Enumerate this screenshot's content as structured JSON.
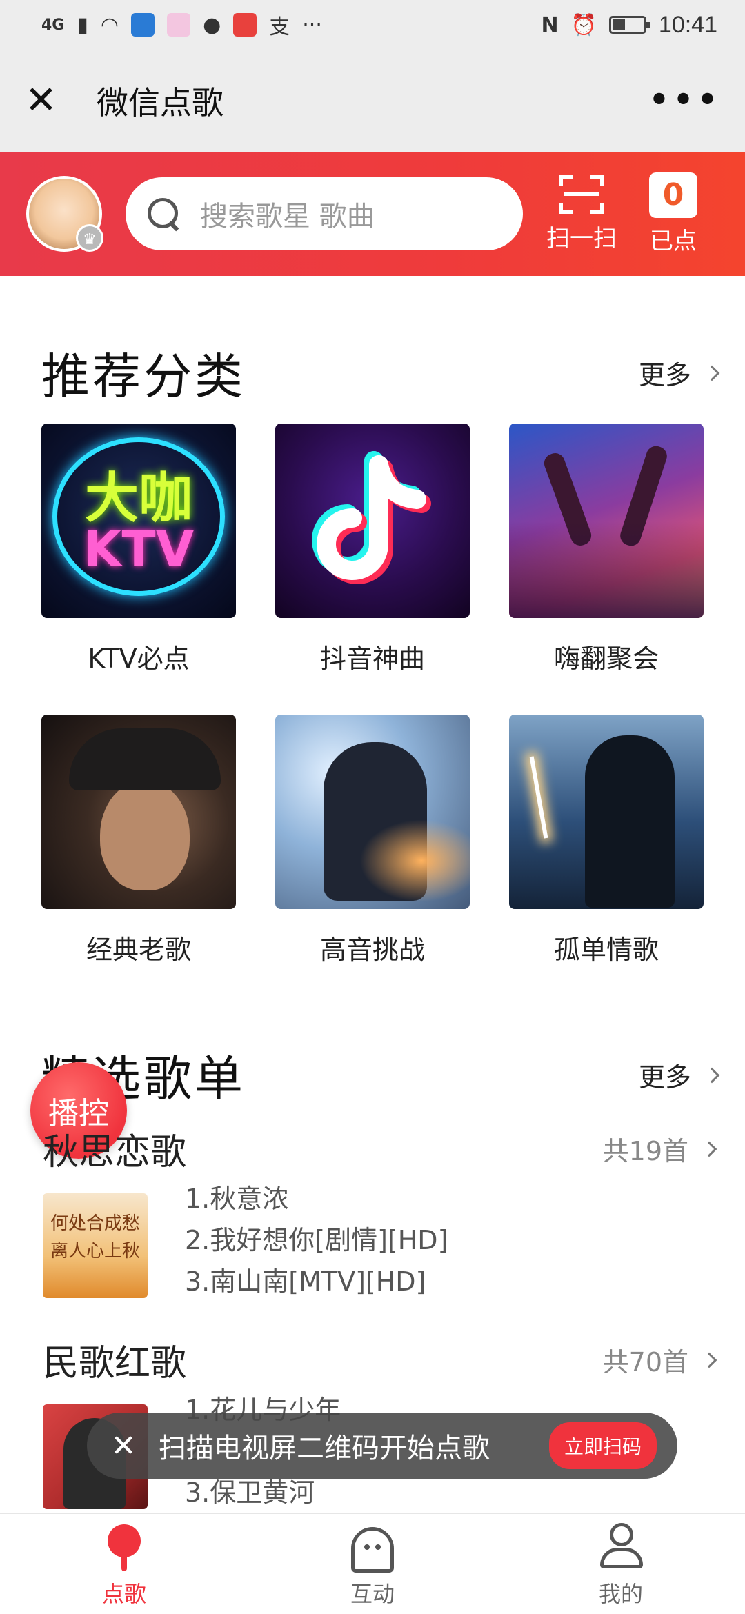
{
  "status_bar": {
    "network": "4G",
    "time": "10:41",
    "nfc_label": "N"
  },
  "titlebar": {
    "close_glyph": "✕",
    "title": "微信点歌",
    "menu_glyph": "•••"
  },
  "header": {
    "search_placeholder": "搜索歌星 歌曲",
    "scan_label": "扫一扫",
    "ordered_count": "0",
    "ordered_label": "已点",
    "accent_color": "#ef3b3b"
  },
  "recommended": {
    "title": "推荐分类",
    "more": "更多",
    "categories": [
      {
        "label": "KTV必点",
        "art_big": "大咖",
        "art_small": "KTV"
      },
      {
        "label": "抖音神曲"
      },
      {
        "label": "嗨翻聚会"
      },
      {
        "label": "经典老歌"
      },
      {
        "label": "高音挑战"
      },
      {
        "label": "孤单情歌"
      }
    ]
  },
  "selected": {
    "title": "精选歌单",
    "more": "更多"
  },
  "fab_label": "播控",
  "playlists": [
    {
      "title": "秋思恋歌",
      "count": "共19首",
      "cover_text": "何处合成愁 离人心上秋",
      "songs": [
        "1.秋意浓",
        "2.我好想你[剧情][HD]",
        "3.南山南[MTV][HD]"
      ]
    },
    {
      "title": "民歌红歌",
      "count": "共70首",
      "songs": [
        "1.花儿与少年",
        "2.",
        "3.保卫黄河"
      ]
    }
  ],
  "toast": {
    "close_glyph": "✕",
    "text": "扫描电视屏二维码开始点歌",
    "button": "立即扫码"
  },
  "tabs": [
    {
      "label": "点歌",
      "icon": "mic-icon",
      "active": true
    },
    {
      "label": "互动",
      "icon": "ghost-icon",
      "active": false
    },
    {
      "label": "我的",
      "icon": "profile-icon",
      "active": false
    }
  ]
}
